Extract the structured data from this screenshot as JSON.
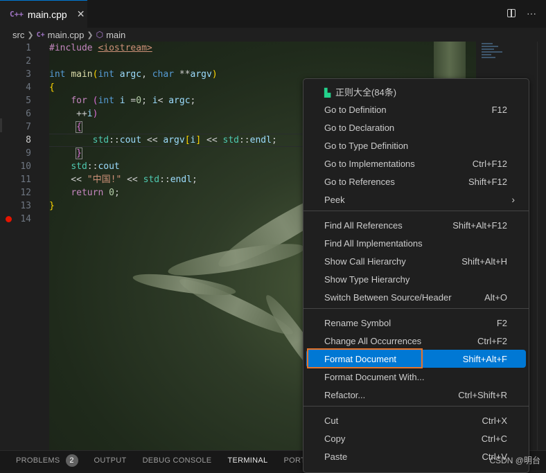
{
  "tab": {
    "icon": "C++",
    "filename": "main.cpp",
    "close": "✕"
  },
  "breadcrumb": {
    "folder": "src",
    "file": "main.cpp",
    "symbol": "main"
  },
  "editor": {
    "line_numbers": [
      "1",
      "2",
      "3",
      "4",
      "5",
      "6",
      "7",
      "8",
      "9",
      "10",
      "11",
      "12",
      "13",
      "14"
    ],
    "active_line": "8",
    "breakpoint_line": "14",
    "code_lines": [
      "#include <iostream>",
      "",
      "int main(int argc, char **argv)",
      "{",
      "    for (int i =0; i< argc;",
      "    ++i)",
      "    {",
      "        std::cout << argv[i] << std::endl;",
      "    }",
      "    std::cout",
      "    << \"中国!\" << std::endl;",
      "    return 0;",
      "}",
      ""
    ]
  },
  "context_menu": {
    "header": "正则大全(84条)",
    "groups": [
      [
        {
          "label": "Go to Definition",
          "shortcut": "F12"
        },
        {
          "label": "Go to Declaration",
          "shortcut": ""
        },
        {
          "label": "Go to Type Definition",
          "shortcut": ""
        },
        {
          "label": "Go to Implementations",
          "shortcut": "Ctrl+F12"
        },
        {
          "label": "Go to References",
          "shortcut": "Shift+F12"
        },
        {
          "label": "Peek",
          "shortcut": ""
        }
      ],
      [
        {
          "label": "Find All References",
          "shortcut": "Shift+Alt+F12"
        },
        {
          "label": "Find All Implementations",
          "shortcut": ""
        },
        {
          "label": "Show Call Hierarchy",
          "shortcut": "Shift+Alt+H"
        },
        {
          "label": "Show Type Hierarchy",
          "shortcut": ""
        },
        {
          "label": "Switch Between Source/Header",
          "shortcut": "Alt+O"
        }
      ],
      [
        {
          "label": "Rename Symbol",
          "shortcut": "F2"
        },
        {
          "label": "Change All Occurrences",
          "shortcut": "Ctrl+F2"
        },
        {
          "label": "Format Document",
          "shortcut": "Shift+Alt+F"
        },
        {
          "label": "Format Document With...",
          "shortcut": ""
        },
        {
          "label": "Refactor...",
          "shortcut": "Ctrl+Shift+R"
        }
      ],
      [
        {
          "label": "Cut",
          "shortcut": "Ctrl+X"
        },
        {
          "label": "Copy",
          "shortcut": "Ctrl+C"
        },
        {
          "label": "Paste",
          "shortcut": "Ctrl+V"
        }
      ]
    ],
    "selected": "Format Document"
  },
  "panel": {
    "tabs": [
      "PROBLEMS",
      "OUTPUT",
      "DEBUG CONSOLE",
      "TERMINAL",
      "PORTS"
    ],
    "problems_count": "2",
    "active": "TERMINAL"
  },
  "watermark": "CSDN @明台",
  "colors": {
    "accent": "#0078d4",
    "highlight_box": "#e8742a",
    "breakpoint": "#e51400"
  }
}
